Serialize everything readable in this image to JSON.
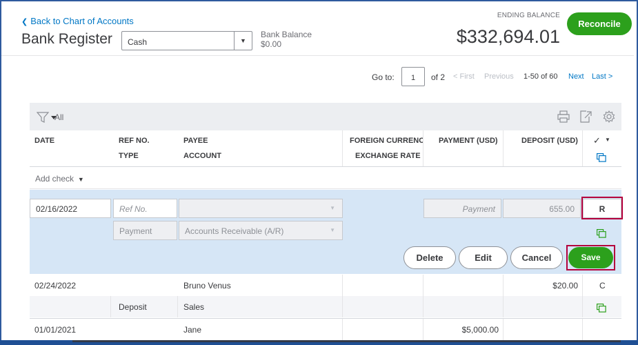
{
  "header": {
    "back_link": "Back to Chart of Accounts",
    "title": "Bank Register",
    "account_selected": "Cash",
    "bank_balance_label": "Bank Balance",
    "bank_balance_value": "$0.00",
    "ending_balance_label": "ENDING BALANCE",
    "ending_balance_value": "$332,694.01",
    "reconcile_label": "Reconcile"
  },
  "pager": {
    "goto_label": "Go to:",
    "page_value": "1",
    "of_label": "of 2",
    "first_label": "< First",
    "previous_label": "Previous",
    "range_label": "1-50 of 60",
    "next_label": "Next",
    "last_label": "Last >"
  },
  "filter": {
    "all_label": "All"
  },
  "columns": {
    "date": "DATE",
    "ref_no": "REF NO.",
    "type": "TYPE",
    "payee": "PAYEE",
    "account": "ACCOUNT",
    "foreign_currency": "FOREIGN CURRENCY",
    "exchange_rate": "EXCHANGE RATE",
    "payment": "PAYMENT (USD)",
    "deposit": "DEPOSIT (USD)",
    "check_mark": "✓"
  },
  "add_check_label": "Add check",
  "edit_row": {
    "date": "02/16/2022",
    "ref_placeholder": "Ref No.",
    "payee": "",
    "payment_placeholder": "Payment",
    "deposit": "655.00",
    "reconcile_status": "R",
    "type": "Payment",
    "account": "Accounts Receivable (A/R)",
    "delete_label": "Delete",
    "edit_label": "Edit",
    "cancel_label": "Cancel",
    "save_label": "Save"
  },
  "rows": [
    {
      "date": "02/24/2022",
      "ref_no": "",
      "payee": "Bruno Venus",
      "payment": "",
      "deposit": "$20.00",
      "status": "C",
      "type": "Deposit",
      "account": "Sales"
    },
    {
      "date": "01/01/2021",
      "ref_no": "",
      "payee": "Jane",
      "payment": "$5,000.00",
      "deposit": "",
      "status": ""
    }
  ],
  "colors": {
    "accent_green": "#2ca01c",
    "link_blue": "#0077c5",
    "highlight_red": "#b4003c",
    "edit_panel_bg": "#d6e6f6",
    "frame_blue": "#2f5a9e"
  }
}
